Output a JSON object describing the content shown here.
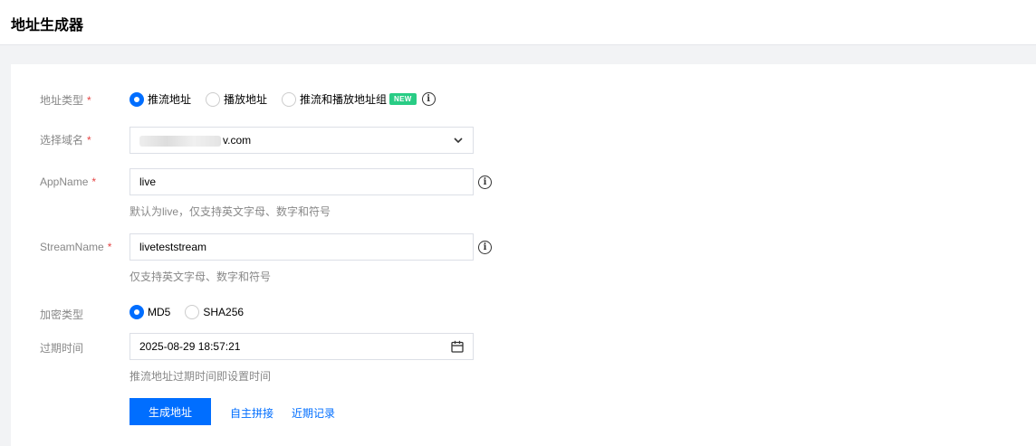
{
  "header": {
    "title": "地址生成器"
  },
  "form": {
    "address_type": {
      "label": "地址类型",
      "required_mark": "*",
      "options": [
        {
          "label": "推流地址",
          "checked": true
        },
        {
          "label": "播放地址",
          "checked": false
        },
        {
          "label": "推流和播放地址组",
          "checked": false
        }
      ],
      "badge": "NEW",
      "info_icon": "info-icon"
    },
    "domain": {
      "label": "选择域名",
      "required_mark": "*",
      "value_prefix": "",
      "value_suffix": "v.com",
      "icon": "chevron-down-icon"
    },
    "app_name": {
      "label": "AppName",
      "required_mark": "*",
      "value": "live",
      "help": "默认为live，仅支持英文字母、数字和符号"
    },
    "stream_name": {
      "label": "StreamName",
      "required_mark": "*",
      "value": "liveteststream",
      "help": "仅支持英文字母、数字和符号"
    },
    "encryption": {
      "label": "加密类型",
      "options": [
        {
          "label": "MD5",
          "checked": true
        },
        {
          "label": "SHA256",
          "checked": false
        }
      ]
    },
    "expiry": {
      "label": "过期时间",
      "value": "2025-08-29 18:57:21",
      "icon": "calendar-icon",
      "help": "推流地址过期时间即设置时间"
    }
  },
  "actions": {
    "generate": "生成地址",
    "custom": "自主拼接",
    "history": "近期记录"
  },
  "colors": {
    "primary": "#006eff",
    "required": "#e54545",
    "badge": "#29cc85"
  }
}
